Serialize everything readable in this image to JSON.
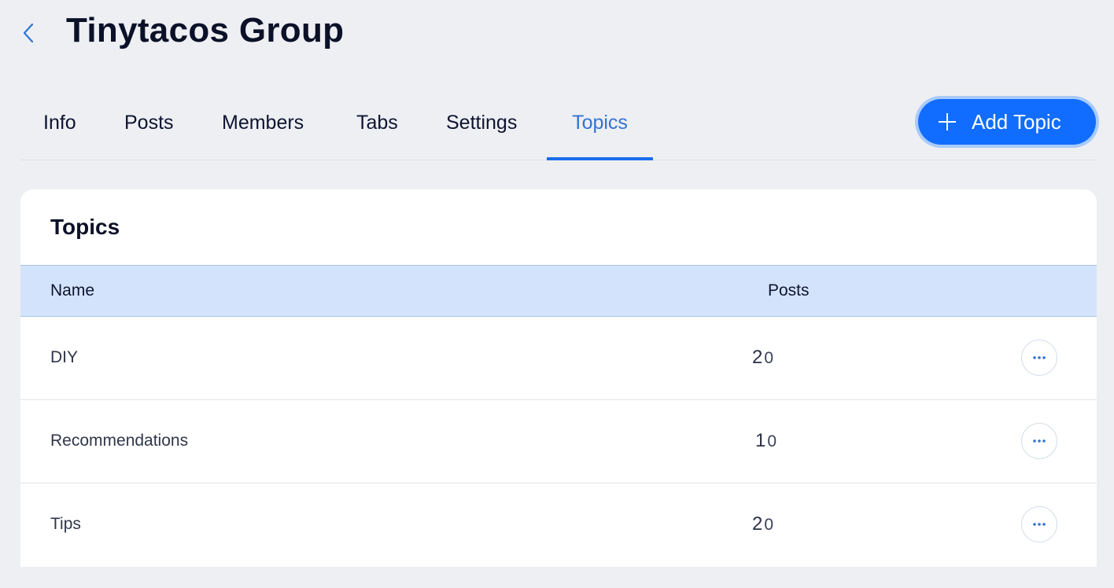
{
  "header": {
    "back_icon": "chevron-left-icon",
    "title": "Tinytacos Group"
  },
  "tabs": [
    {
      "label": "Info",
      "active": false
    },
    {
      "label": "Posts",
      "active": false
    },
    {
      "label": "Members",
      "active": false
    },
    {
      "label": "Tabs",
      "active": false
    },
    {
      "label": "Settings",
      "active": false
    },
    {
      "label": "Topics",
      "active": true
    }
  ],
  "actions": {
    "add_topic_label": "Add Topic",
    "add_topic_icon": "plus-icon"
  },
  "colors": {
    "accent": "#116dff",
    "active_tab": "#2f74d6",
    "table_header_bg": "#d4e3fc",
    "page_bg": "#eeeff3"
  },
  "topics_card": {
    "title": "Topics",
    "columns": [
      "Name",
      "Posts"
    ],
    "rows": [
      {
        "name": "DIY",
        "posts_main": "2",
        "posts_suffix": "0"
      },
      {
        "name": "Recommendations",
        "posts_main": "1",
        "posts_suffix": "0"
      },
      {
        "name": "Tips",
        "posts_main": "2",
        "posts_suffix": "0"
      }
    ],
    "row_action_icon": "more-horizontal-icon"
  }
}
